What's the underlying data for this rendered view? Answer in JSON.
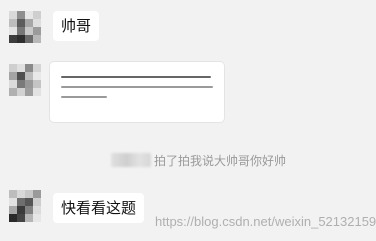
{
  "messages": [
    {
      "sender": "friend",
      "type": "text",
      "text": "帅哥"
    },
    {
      "sender": "friend",
      "type": "image",
      "content": "blurred screenshot of a question"
    },
    {
      "sender": "system",
      "type": "pat",
      "text": "拍了拍我说大帅哥你好帅"
    },
    {
      "sender": "friend",
      "type": "text",
      "text": "快看看这题"
    }
  ],
  "watermark": "https://blog.csdn.net/weixin_52132159",
  "colors": {
    "background": "#f2f2f2",
    "bubble": "#ffffff",
    "system_text": "#9a9a9a"
  }
}
